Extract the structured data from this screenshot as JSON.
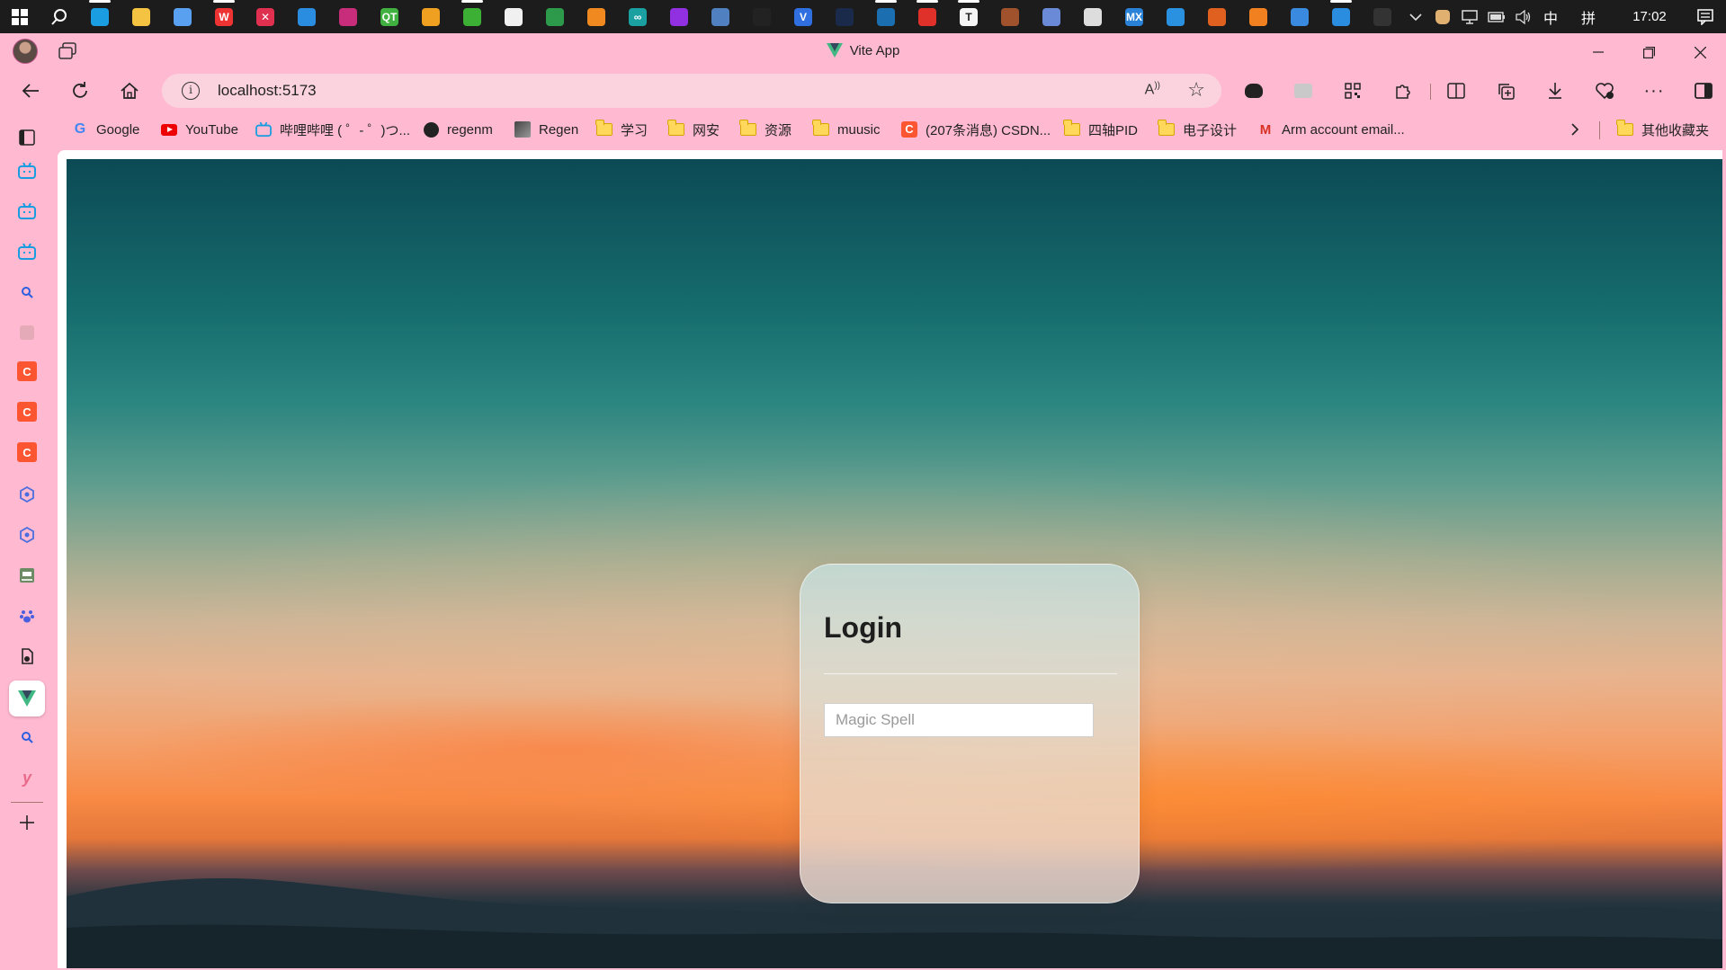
{
  "taskbar": {
    "time": "17:02",
    "ime": "中",
    "ime2": "拼",
    "apps": [
      {
        "icon": "edge-icon",
        "color": "#1b9de2",
        "glyph": "",
        "running": true
      },
      {
        "icon": "file-explorer-icon",
        "color": "#f5c342",
        "glyph": "",
        "running": false
      },
      {
        "icon": "paper-plane-icon",
        "color": "#5aa0f0",
        "glyph": "",
        "running": false
      },
      {
        "icon": "wps-icon",
        "color": "#e33",
        "glyph": "W",
        "running": true
      },
      {
        "icon": "xmind-icon",
        "color": "#e03050",
        "glyph": "✕",
        "running": false
      },
      {
        "icon": "vscode-icon",
        "color": "#2a8de0",
        "glyph": "",
        "running": false
      },
      {
        "icon": "pycharm-icon",
        "color": "#c72d7a",
        "glyph": "",
        "running": false
      },
      {
        "icon": "qt-icon",
        "color": "#40b040",
        "glyph": "QT",
        "running": false
      },
      {
        "icon": "copy-app-icon",
        "color": "#f0a020",
        "glyph": "",
        "running": false
      },
      {
        "icon": "wechat-icon",
        "color": "#3cb034",
        "glyph": "",
        "running": true
      },
      {
        "icon": "notepad-icon",
        "color": "#f0f0f0",
        "glyph": "",
        "running": false
      },
      {
        "icon": "green-doc-icon",
        "color": "#2c9a4a",
        "glyph": "",
        "running": false
      },
      {
        "icon": "orange-blocks-icon",
        "color": "#f08a20",
        "glyph": "",
        "running": false
      },
      {
        "icon": "arduino-icon",
        "color": "#1aa0a0",
        "glyph": "∞",
        "running": false
      },
      {
        "icon": "rss-icon",
        "color": "#9030e0",
        "glyph": "",
        "running": false
      },
      {
        "icon": "game-icon",
        "color": "#5080c0",
        "glyph": "",
        "running": false
      },
      {
        "icon": "qq-icon",
        "color": "#222",
        "glyph": "",
        "running": false
      },
      {
        "icon": "v-app-icon",
        "color": "#2f6fe0",
        "glyph": "V",
        "running": false
      },
      {
        "icon": "dark-app-icon",
        "color": "#1a2a4a",
        "glyph": "",
        "running": false
      },
      {
        "icon": "steam-icon",
        "color": "#1b6fb0",
        "glyph": "",
        "running": true
      },
      {
        "icon": "netease-music-icon",
        "color": "#e0302a",
        "glyph": "",
        "running": true
      },
      {
        "icon": "typora-icon",
        "color": "#f5f5f5",
        "glyph": "T",
        "running": true
      },
      {
        "icon": "bear-icon",
        "color": "#a0522d",
        "glyph": "",
        "running": false
      },
      {
        "icon": "remote-icon",
        "color": "#6a8ad8",
        "glyph": "",
        "running": false
      },
      {
        "icon": "photo-app-icon",
        "color": "#ddd",
        "glyph": "",
        "running": false
      },
      {
        "icon": "mx-icon",
        "color": "#2a82d8",
        "glyph": "MX",
        "running": false
      },
      {
        "icon": "cloud-icon",
        "color": "#2a90e0",
        "glyph": "",
        "running": false
      },
      {
        "icon": "matlab-icon",
        "color": "#e06020",
        "glyph": "",
        "running": false
      },
      {
        "icon": "firefox-icon",
        "color": "#f08020",
        "glyph": "",
        "running": false
      },
      {
        "icon": "blue-window-icon",
        "color": "#3a8ae0",
        "glyph": "",
        "running": false
      },
      {
        "icon": "vscode-icon-2",
        "color": "#2a8de0",
        "glyph": "",
        "running": true
      },
      {
        "icon": "terminal-icon",
        "color": "#333",
        "glyph": "",
        "running": false
      }
    ]
  },
  "window": {
    "title": "Vite App"
  },
  "address": {
    "url": "localhost:5173",
    "read_aloud": "A",
    "favorite_icon": "star-icon"
  },
  "bookmarks": [
    {
      "label": "Google",
      "icon": "google-icon"
    },
    {
      "label": "YouTube",
      "icon": "youtube-icon"
    },
    {
      "label": "哔哩哔哩 ( ゜- ゜)つ...",
      "icon": "bilibili-icon"
    },
    {
      "label": "regenm",
      "icon": "github-icon"
    },
    {
      "label": "Regen",
      "icon": "avatar-icon"
    },
    {
      "label": "学习",
      "icon": "folder-icon"
    },
    {
      "label": "网安",
      "icon": "folder-icon"
    },
    {
      "label": "资源",
      "icon": "folder-icon"
    },
    {
      "label": "muusic",
      "icon": "folder-icon"
    },
    {
      "label": "(207条消息) CSDN...",
      "icon": "csdn-icon"
    },
    {
      "label": "四轴PID",
      "icon": "folder-icon"
    },
    {
      "label": "电子设计",
      "icon": "folder-icon"
    },
    {
      "label": "Arm account email...",
      "icon": "gmail-icon"
    }
  ],
  "bookmarks_other": "其他收藏夹",
  "login": {
    "title": "Login",
    "input_placeholder": "Magic Spell",
    "input_value": ""
  }
}
